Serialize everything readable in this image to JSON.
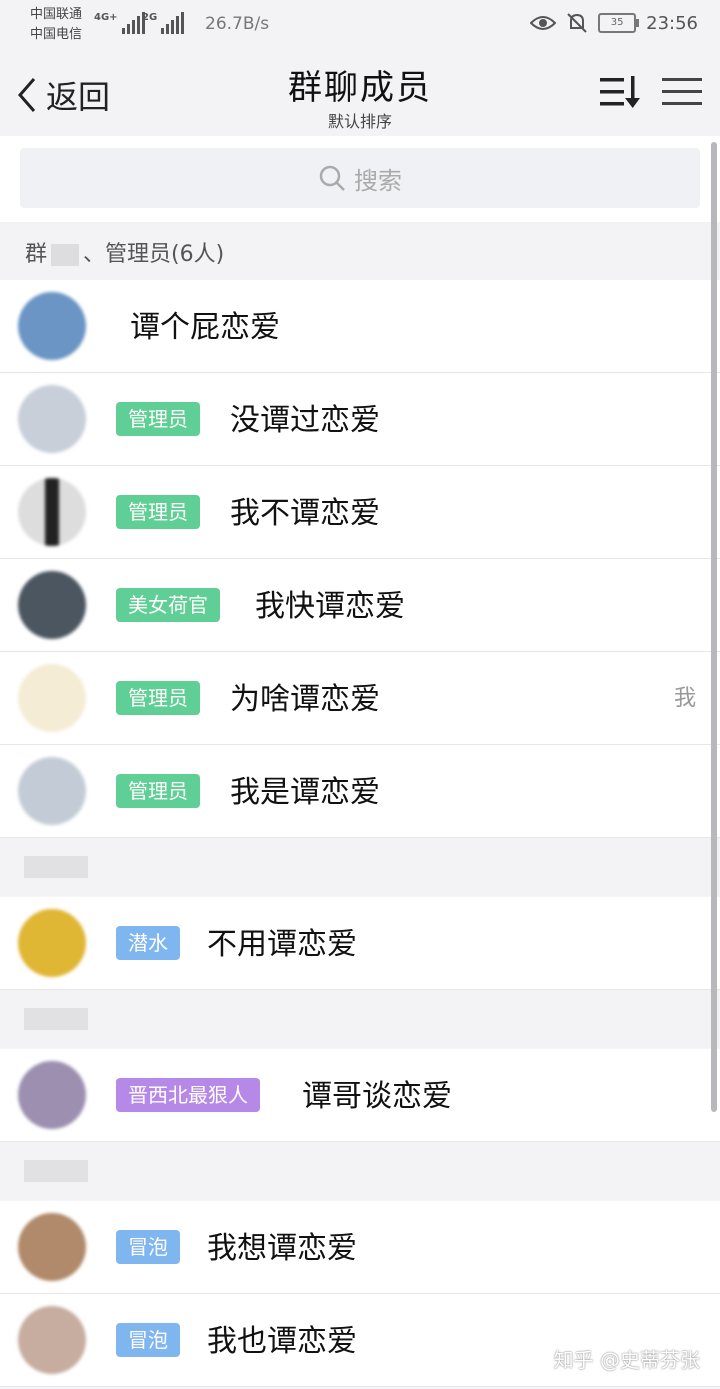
{
  "status_bar": {
    "carrier_1": "中国联通",
    "carrier_2": "中国电信",
    "sig1_tag": "4G+",
    "sig2_tag": "2G",
    "net_speed": "26.7B/s",
    "battery": "35",
    "time": "23:56"
  },
  "nav": {
    "back_label": "返回",
    "title": "群聊成员",
    "subtitle": "默认排序"
  },
  "search": {
    "placeholder": "搜索"
  },
  "sections": [
    {
      "label_start": "群",
      "label_end": "、管理员(6人)"
    }
  ],
  "members": [
    {
      "name": "谭个屁恋爱",
      "badge": "",
      "badge_color": "",
      "avatar_color": "#6a95c4"
    },
    {
      "name": "没谭过恋爱",
      "badge": "管理员",
      "badge_color": "#5fcf95",
      "avatar_color": "#c8cfd9"
    },
    {
      "name": "我不谭恋爱",
      "badge": "管理员",
      "badge_color": "#5fcf95",
      "avatar_color": "#3a3a3a"
    },
    {
      "name": "我快谭恋爱",
      "badge": "美女荷官",
      "badge_color": "#5fcf95",
      "avatar_color": "#4b5660"
    },
    {
      "name": "为啥谭恋爱",
      "badge": "管理员",
      "badge_color": "#5fcf95",
      "avatar_color": "#f4ecd5",
      "me": "我"
    },
    {
      "name": "我是谭恋爱",
      "badge": "管理员",
      "badge_color": "#5fcf95",
      "avatar_color": "#c3ccd6"
    },
    {
      "name": "不用谭恋爱",
      "badge": "潜水",
      "badge_color": "#7fb6f0",
      "avatar_color": "#e0b635"
    },
    {
      "name": "谭哥谈恋爱",
      "badge": "晋西北最狠人",
      "badge_color": "#b688e8",
      "avatar_color": "#9c8fb0"
    },
    {
      "name": "我想谭恋爱",
      "badge": "冒泡",
      "badge_color": "#7fb6f0",
      "avatar_color": "#b08a6a"
    },
    {
      "name": "我也谭恋爱",
      "badge": "冒泡",
      "badge_color": "#7fb6f0",
      "avatar_color": "#c7aca0"
    }
  ],
  "watermark": "知乎 @史蒂芬张"
}
